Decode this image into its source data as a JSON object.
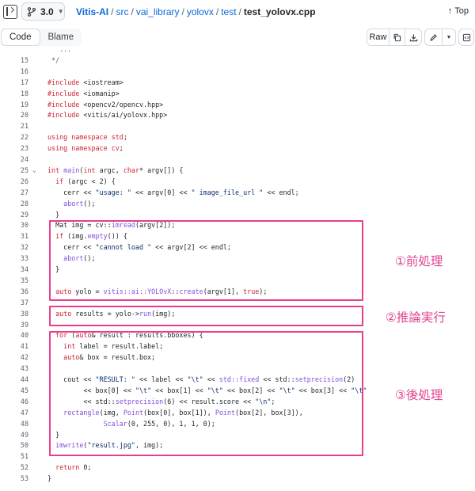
{
  "header": {
    "branch": "3.0",
    "breadcrumb": {
      "repo": "Vitis-AI",
      "sep": "/",
      "parts": [
        "src",
        "vai_library",
        "yolovx",
        "test"
      ],
      "file": "test_yolovx.cpp"
    },
    "top_link": "Top"
  },
  "toolbar": {
    "tabs": [
      "Code",
      "Blame"
    ],
    "raw_label": "Raw"
  },
  "code": {
    "lines": [
      {
        "n": "",
        "t": "   ..."
      },
      {
        "n": "15",
        "t": " */"
      },
      {
        "n": "16",
        "t": ""
      },
      {
        "n": "17",
        "t": "#include <iostream>"
      },
      {
        "n": "18",
        "t": "#include <iomanip>"
      },
      {
        "n": "19",
        "t": "#include <opencv2/opencv.hpp>"
      },
      {
        "n": "20",
        "t": "#include <vitis/ai/yolovx.hpp>"
      },
      {
        "n": "21",
        "t": ""
      },
      {
        "n": "22",
        "t": "using namespace std;"
      },
      {
        "n": "23",
        "t": "using namespace cv;"
      },
      {
        "n": "24",
        "t": ""
      },
      {
        "n": "25",
        "t": "int main(int argc, char* argv[]) {"
      },
      {
        "n": "26",
        "t": "  if (argc < 2) {"
      },
      {
        "n": "27",
        "t": "    cerr << \"usage: \" << argv[0] << \" image_file_url \" << endl;"
      },
      {
        "n": "28",
        "t": "    abort();"
      },
      {
        "n": "29",
        "t": "  }"
      },
      {
        "n": "30",
        "t": "  Mat img = cv::imread(argv[2]);"
      },
      {
        "n": "31",
        "t": "  if (img.empty()) {"
      },
      {
        "n": "32",
        "t": "    cerr << \"cannot load \" << argv[2] << endl;"
      },
      {
        "n": "33",
        "t": "    abort();"
      },
      {
        "n": "34",
        "t": "  }"
      },
      {
        "n": "35",
        "t": ""
      },
      {
        "n": "36",
        "t": "  auto yolo = vitis::ai::YOLOvX::create(argv[1], true);"
      },
      {
        "n": "37",
        "t": ""
      },
      {
        "n": "38",
        "t": "  auto results = yolo->run(img);"
      },
      {
        "n": "39",
        "t": ""
      },
      {
        "n": "40",
        "t": "  for (auto& result : results.bboxes) {"
      },
      {
        "n": "41",
        "t": "    int label = result.label;"
      },
      {
        "n": "42",
        "t": "    auto& box = result.box;"
      },
      {
        "n": "43",
        "t": ""
      },
      {
        "n": "44",
        "t": "    cout << \"RESULT: \" << label << \"\\t\" << std::fixed << std::setprecision(2)"
      },
      {
        "n": "45",
        "t": "         << box[0] << \"\\t\" << box[1] << \"\\t\" << box[2] << \"\\t\" << box[3] << \"\\t\""
      },
      {
        "n": "46",
        "t": "         << std::setprecision(6) << result.score << \"\\n\";"
      },
      {
        "n": "47",
        "t": "    rectangle(img, Point(box[0], box[1]), Point(box[2], box[3]),"
      },
      {
        "n": "48",
        "t": "              Scalar(0, 255, 0), 1, 1, 0);"
      },
      {
        "n": "49",
        "t": "  }"
      },
      {
        "n": "50",
        "t": "  imwrite(\"result.jpg\", img);"
      },
      {
        "n": "51",
        "t": ""
      },
      {
        "n": "52",
        "t": "  return 0;"
      },
      {
        "n": "53",
        "t": "}"
      }
    ]
  },
  "annotations": [
    {
      "label": "①前処理"
    },
    {
      "label": "②推論実行"
    },
    {
      "label": "③後処理"
    }
  ],
  "colors": {
    "annotation": "#e83e8c",
    "link": "#0969da",
    "keyword": "#cf222e",
    "function": "#8250df",
    "string": "#0a3069"
  }
}
